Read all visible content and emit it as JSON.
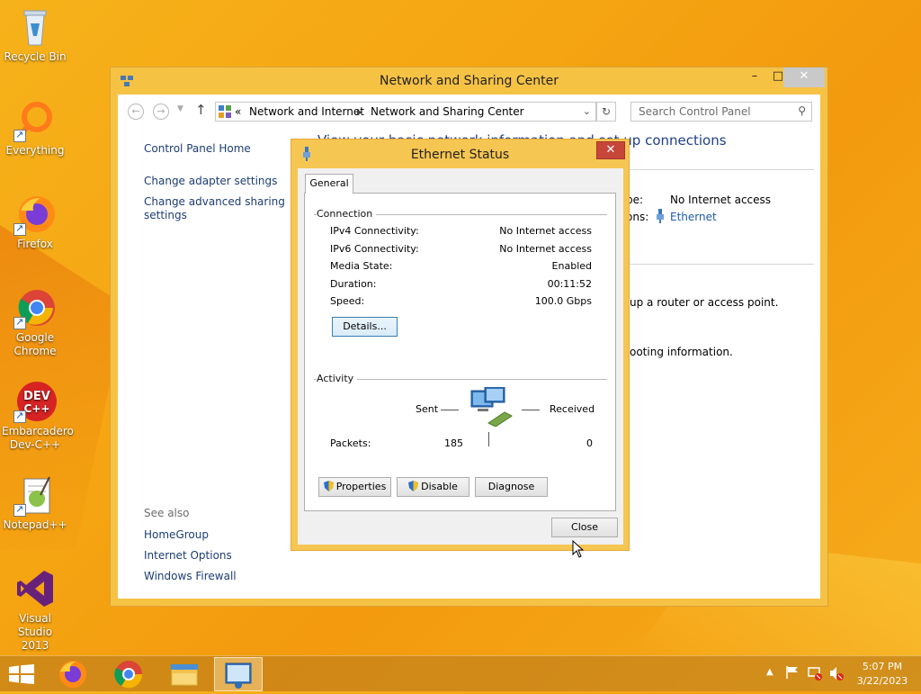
{
  "desktop": {
    "icons": [
      {
        "label": "Recycle Bin"
      },
      {
        "label": "Everything"
      },
      {
        "label": "Firefox"
      },
      {
        "label": "Google Chrome"
      },
      {
        "label": "Embarcadero Dev-C++"
      },
      {
        "label": "Notepad++"
      },
      {
        "label": "Visual Studio 2013"
      }
    ]
  },
  "main_window": {
    "title": "Network and Sharing Center",
    "address": {
      "prefix": "«",
      "crumbs": [
        "Network and Internet",
        "Network and Sharing Center"
      ]
    },
    "search_placeholder": "Search Control Panel",
    "left_nav": {
      "home": "Control Panel Home",
      "change_adapter": "Change adapter settings",
      "change_sharing_1": "Change advanced sharing",
      "change_sharing_2": "settings",
      "see_also": "See also",
      "homegroup": "HomeGroup",
      "internet_options": "Internet Options",
      "windows_firewall": "Windows Firewall"
    },
    "content": {
      "heading": "View your basic network information and set up connections",
      "access_type_label": "pe:",
      "access_type_value": "No Internet access",
      "connections_label": "ons:",
      "connections_value": "Ethernet",
      "router_text": "up a router or access point.",
      "troubleshoot_text": "ooting information."
    }
  },
  "dialog": {
    "title": "Ethernet Status",
    "tab_general": "General",
    "connection_group": "Connection",
    "rows": [
      {
        "label": "IPv4 Connectivity:",
        "value": "No Internet access"
      },
      {
        "label": "IPv6 Connectivity:",
        "value": "No Internet access"
      },
      {
        "label": "Media State:",
        "value": "Enabled"
      },
      {
        "label": "Duration:",
        "value": "00:11:52"
      },
      {
        "label": "Speed:",
        "value": "100.0 Gbps"
      }
    ],
    "details_button": "Details...",
    "activity_group": "Activity",
    "sent_label": "Sent",
    "received_label": "Received",
    "packets_label": "Packets:",
    "packets_sent": "185",
    "packets_received": "0",
    "properties_button": "Properties",
    "disable_button": "Disable",
    "diagnose_button": "Diagnose",
    "close_button": "Close"
  },
  "taskbar": {
    "time": "5:07 PM",
    "date": "3/22/2023"
  },
  "colors": {
    "accent": "#f6c244",
    "link": "#1f58a8",
    "close_red": "#c7463a"
  }
}
